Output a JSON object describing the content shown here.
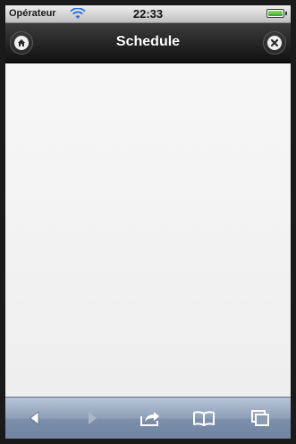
{
  "status_bar": {
    "carrier": "Opérateur",
    "time": "22:33",
    "battery_level": 1.0
  },
  "header": {
    "title": "Schedule",
    "left_icon": "home-icon",
    "right_icon": "close-icon"
  },
  "toolbar": {
    "icons": [
      "back-arrow-icon",
      "forward-arrow-icon",
      "share-icon",
      "bookmarks-icon",
      "pages-icon"
    ]
  },
  "colors": {
    "header_top": "#3c3c3c",
    "header_bottom": "#111111",
    "content_bg": "#f3f3f3",
    "toolbar_blue": "#8c9db6",
    "wifi_blue": "#2a6fd6"
  }
}
